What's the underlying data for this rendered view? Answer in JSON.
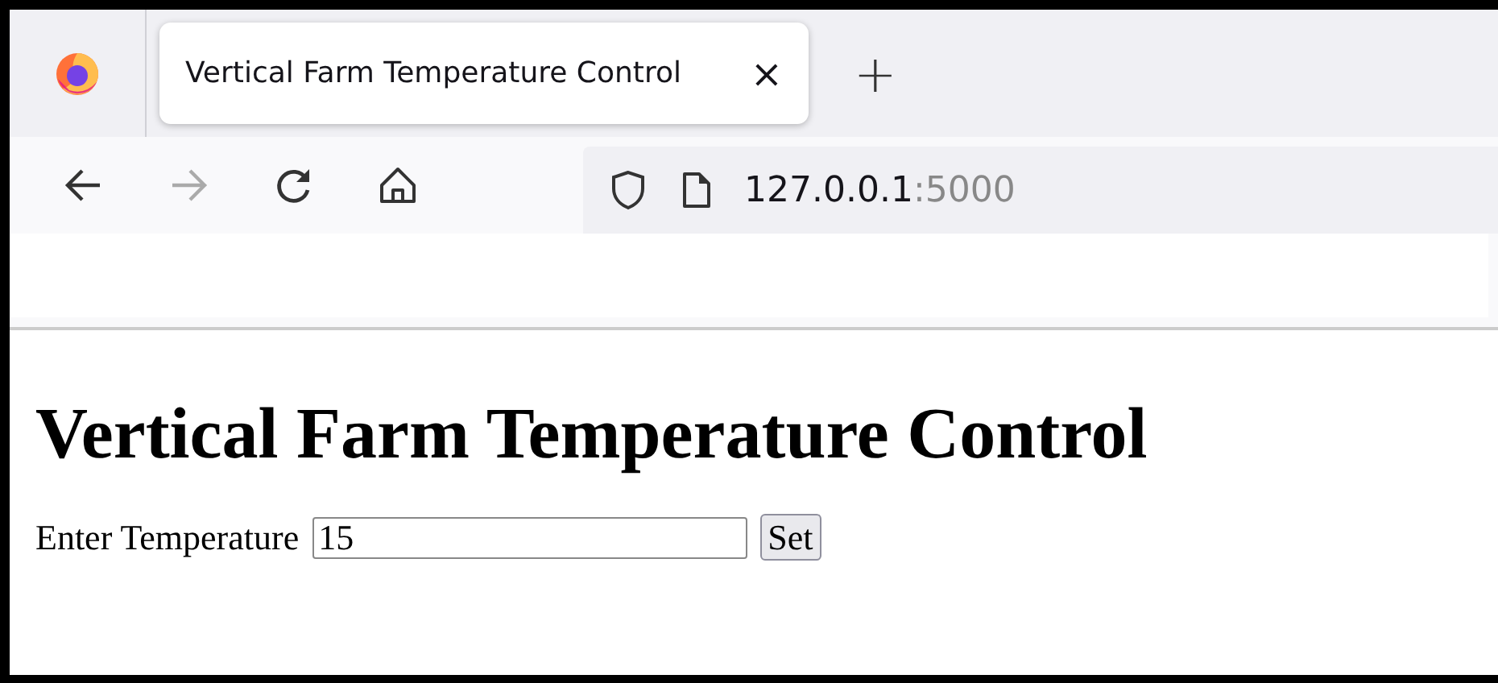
{
  "tabs": [
    {
      "title": "Vertical Farm Temperature Control",
      "selected": true,
      "close": "×"
    }
  ],
  "new_tab": "+",
  "address": {
    "host": "127.0.0.1",
    "port": ":5000"
  },
  "page": {
    "heading": "Vertical Farm Temperature Control",
    "label": "Enter Temperature",
    "value": "15",
    "button": "Set"
  }
}
